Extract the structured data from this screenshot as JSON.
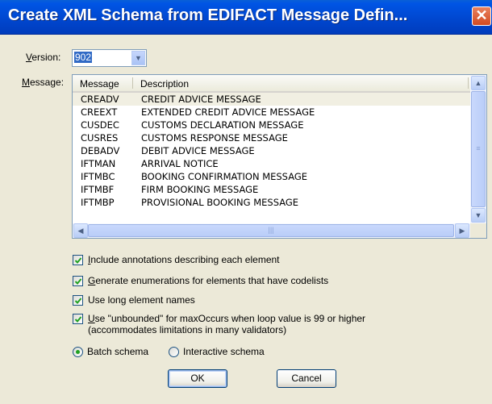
{
  "window": {
    "title": "Create XML Schema from EDIFACT Message Defin...",
    "close_glyph": "✕"
  },
  "version": {
    "label_underlined": "V",
    "label_rest": "ersion:",
    "value": "902"
  },
  "message": {
    "label_underlined": "M",
    "label_rest": "essage:",
    "columns": [
      "Message",
      "Description"
    ],
    "rows": [
      {
        "code": "CREADV",
        "description": "CREDIT ADVICE MESSAGE"
      },
      {
        "code": "CREEXT",
        "description": "EXTENDED CREDIT ADVICE MESSAGE"
      },
      {
        "code": "CUSDEC",
        "description": "CUSTOMS DECLARATION MESSAGE"
      },
      {
        "code": "CUSRES",
        "description": "CUSTOMS RESPONSE MESSAGE"
      },
      {
        "code": "DEBADV",
        "description": "DEBIT ADVICE MESSAGE"
      },
      {
        "code": "IFTMAN",
        "description": "ARRIVAL NOTICE"
      },
      {
        "code": "IFTMBC",
        "description": "BOOKING CONFIRMATION MESSAGE"
      },
      {
        "code": "IFTMBF",
        "description": "FIRM BOOKING MESSAGE"
      },
      {
        "code": "IFTMBP",
        "description": "PROVISIONAL BOOKING MESSAGE"
      }
    ]
  },
  "options": {
    "annotations": {
      "u": "I",
      "rest": "nclude annotations describing each element",
      "checked": true
    },
    "enumerations": {
      "u": "G",
      "rest": "enerate enumerations for elements that have codelists",
      "checked": true
    },
    "long_names": {
      "u": "",
      "rest": "Use long element names",
      "checked": true
    },
    "unbounded": {
      "u": "U",
      "rest": "se \"unbounded\" for maxOccurs when loop value is 99 or higher",
      "line2": "(accommodates limitations in many validators)",
      "checked": true
    }
  },
  "schema_mode": {
    "batch_label": "Batch schema",
    "interactive_label": "Interactive schema",
    "selected": "batch"
  },
  "buttons": {
    "ok": "OK",
    "cancel": "Cancel"
  },
  "icons": {
    "close": "close-icon",
    "dropdown": "chevron-down-icon",
    "check": "checkmark-icon"
  }
}
